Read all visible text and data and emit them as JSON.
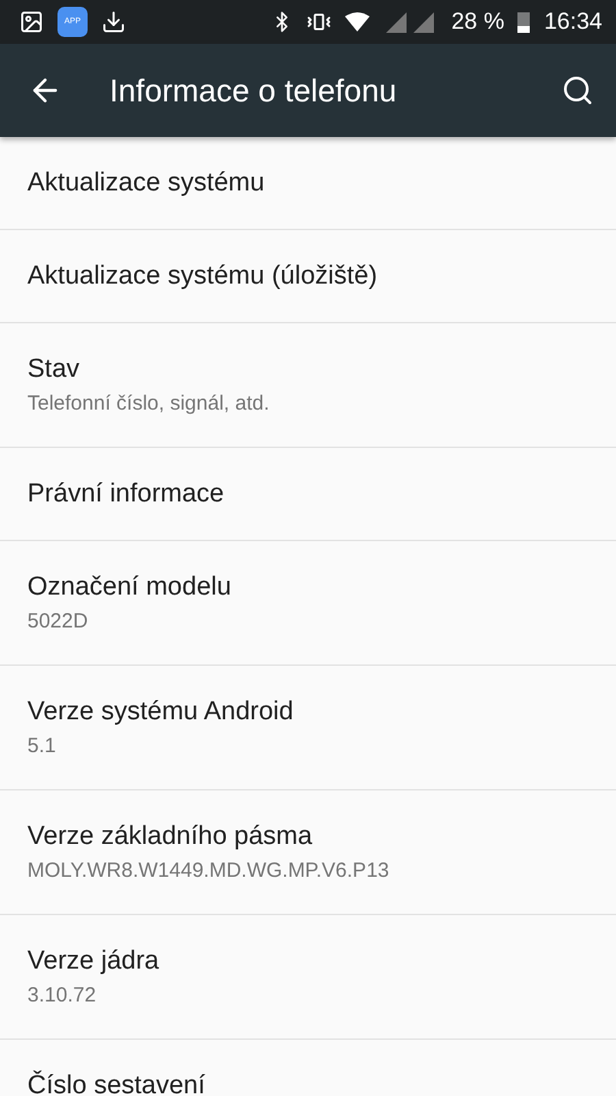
{
  "status_bar": {
    "app_icon_label": "APP",
    "battery": "28 %",
    "time": "16:34"
  },
  "toolbar": {
    "title": "Informace o telefonu"
  },
  "items": [
    {
      "title": "Aktualizace systému"
    },
    {
      "title": "Aktualizace systému (úložiště)"
    },
    {
      "title": "Stav",
      "summary": "Telefonní číslo, signál, atd."
    },
    {
      "title": "Právní informace"
    },
    {
      "title": "Označení modelu",
      "summary": "5022D"
    },
    {
      "title": "Verze systému Android",
      "summary": "5.1"
    },
    {
      "title": "Verze základního pásma",
      "summary": "MOLY.WR8.W1449.MD.WG.MP.V6.P13"
    },
    {
      "title": "Verze jádra",
      "summary": "3.10.72"
    },
    {
      "title": "Číslo sestavení"
    }
  ]
}
